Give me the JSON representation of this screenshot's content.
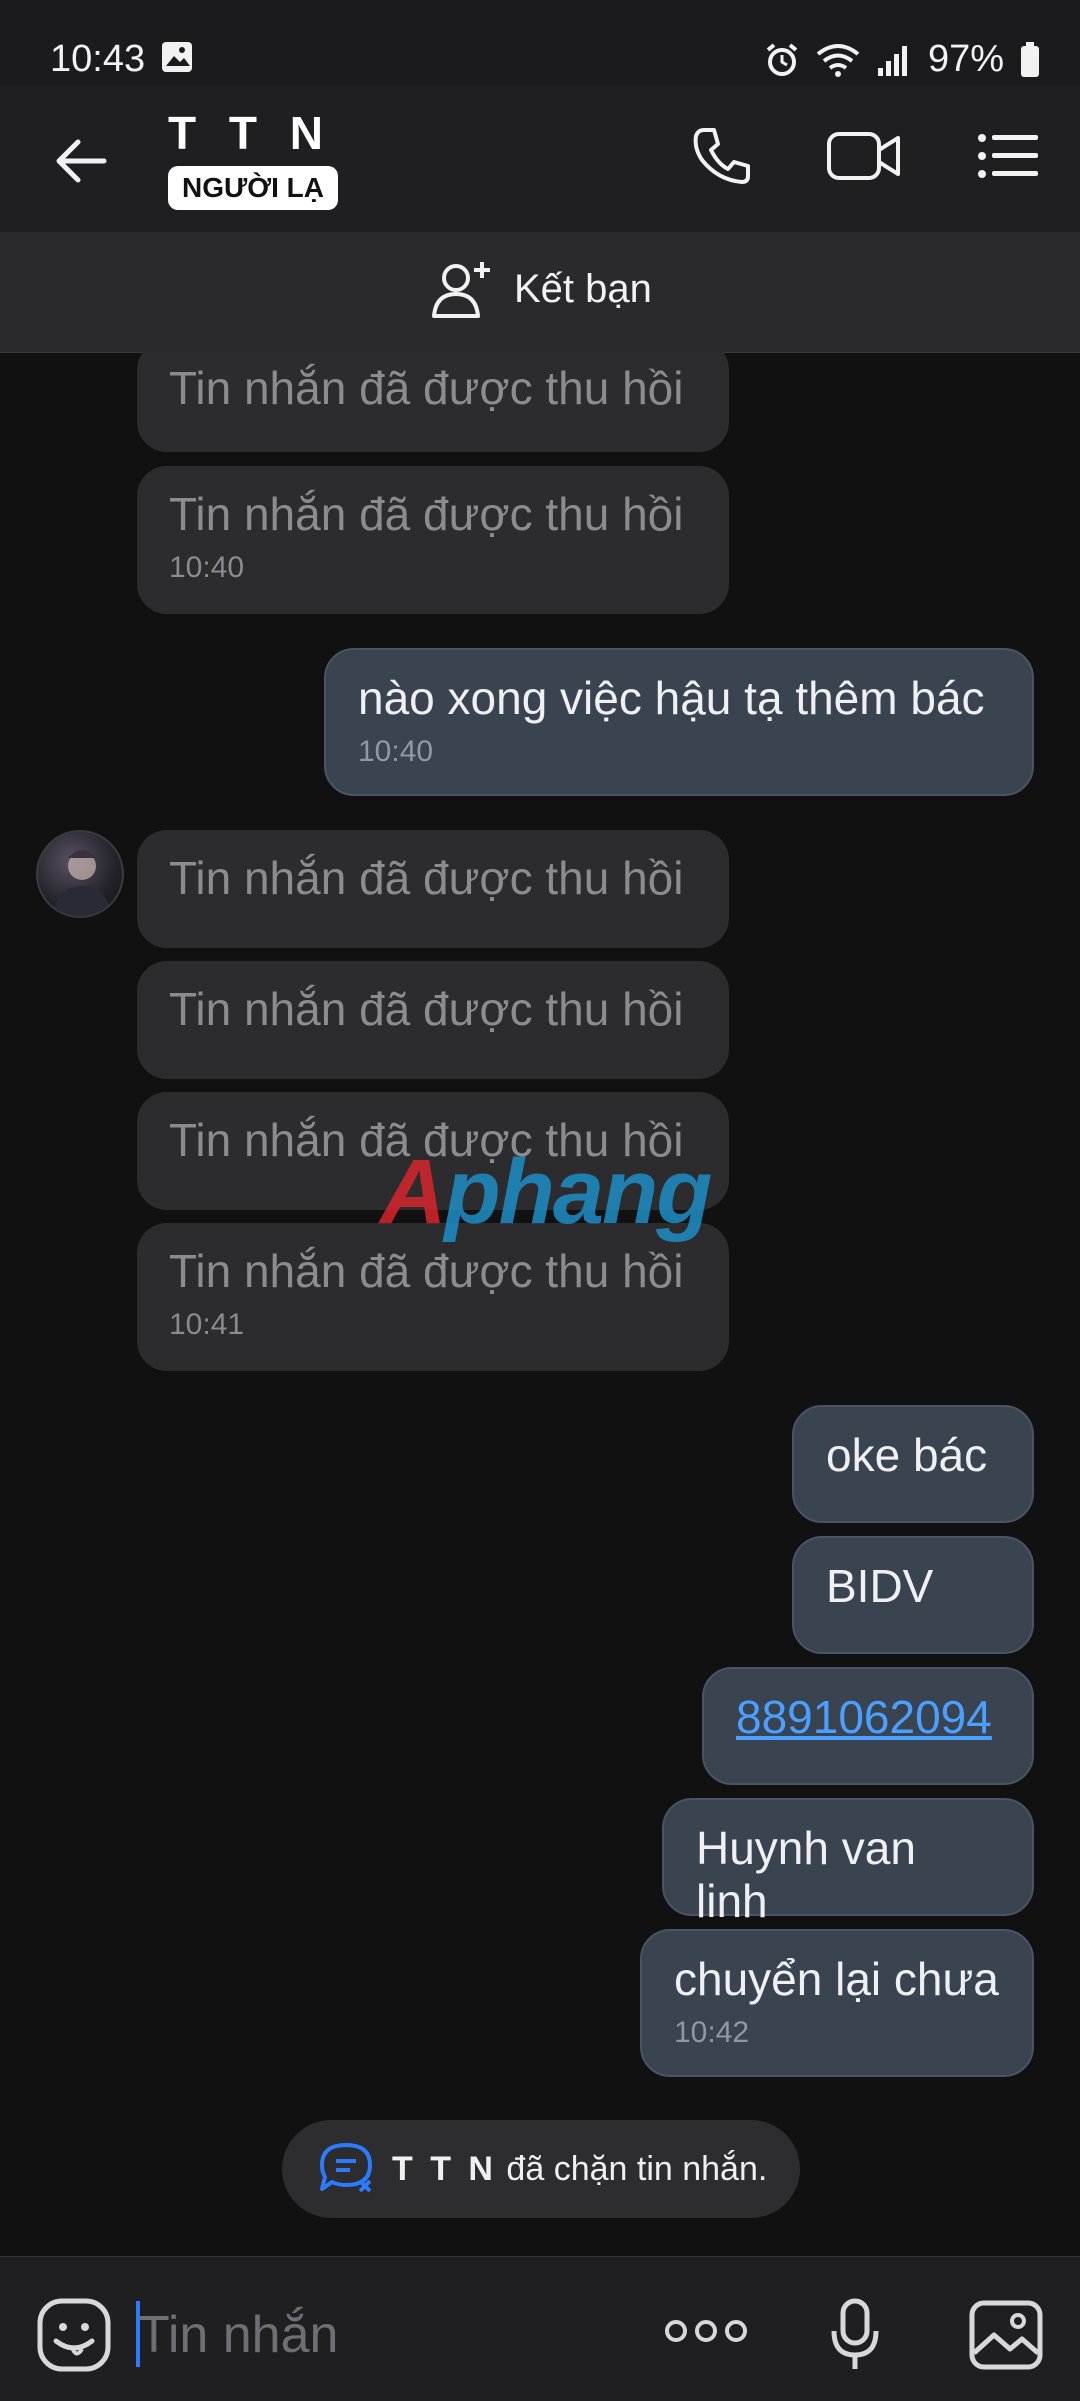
{
  "status_bar": {
    "time": "10:43",
    "battery": "97%"
  },
  "header": {
    "contact_name": "T T N",
    "stranger_badge": "NGƯỜI LẠ"
  },
  "friend_bar": {
    "label": "Kết bạn"
  },
  "messages": [
    {
      "text": "Tin nhắn đã được thu hồi",
      "time": ""
    },
    {
      "text": "Tin nhắn đã được thu hồi",
      "time": "10:40"
    },
    {
      "text": "nào xong việc hậu tạ thêm bác",
      "time": "10:40"
    },
    {
      "text": "Tin nhắn đã được thu hồi",
      "time": ""
    },
    {
      "text": "Tin nhắn đã được thu hồi",
      "time": ""
    },
    {
      "text": "Tin nhắn đã được thu hồi",
      "time": ""
    },
    {
      "text": "Tin nhắn đã được thu hồi",
      "time": "10:41"
    },
    {
      "text": "oke bác",
      "time": ""
    },
    {
      "text": "BIDV",
      "time": ""
    },
    {
      "text": "8891062094",
      "time": ""
    },
    {
      "text": "Huynh van linh",
      "time": ""
    },
    {
      "text": "chuyển lại chưa",
      "time": "10:42"
    }
  ],
  "watermark": {
    "a": "A",
    "rest": "phang"
  },
  "block_notice": {
    "name": "T T N",
    "text": " đã chặn tin nhắn."
  },
  "input": {
    "placeholder": "Tin nhắn"
  },
  "colors": {
    "accent": "#2b7bff",
    "link": "#4aa0ff",
    "mine_bubble": "#3a4350",
    "recalled_bubble": "#2c2c2e"
  }
}
